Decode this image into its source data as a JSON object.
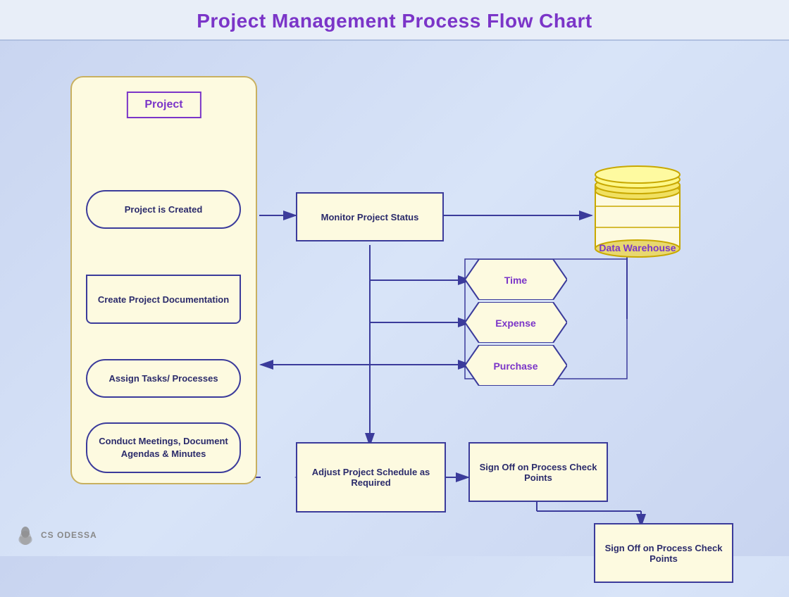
{
  "page": {
    "title": "Project Management Process Flow Chart",
    "background_color": "#c8d4f0"
  },
  "swimlane": {
    "title": "Project",
    "nodes": [
      {
        "id": "project-created",
        "label": "Project is Created",
        "type": "rounded"
      },
      {
        "id": "create-doc",
        "label": "Create Project Documentation",
        "type": "document"
      },
      {
        "id": "assign-tasks",
        "label": "Assign Tasks/ Processes",
        "type": "rounded"
      },
      {
        "id": "conduct-meetings",
        "label": "Conduct Meetings, Document Agendas & Minutes",
        "type": "rounded"
      }
    ]
  },
  "nodes": [
    {
      "id": "monitor-status",
      "label": "Monitor Project Status",
      "type": "rect"
    },
    {
      "id": "data-warehouse",
      "label": "Data Warehouse",
      "type": "cylinder"
    },
    {
      "id": "time",
      "label": "Time",
      "type": "hex"
    },
    {
      "id": "expense",
      "label": "Expense",
      "type": "hex"
    },
    {
      "id": "purchase",
      "label": "Purchase",
      "type": "hex"
    },
    {
      "id": "adjust-schedule",
      "label": "Adjust Project Schedule as Required",
      "type": "rect"
    },
    {
      "id": "signoff-1",
      "label": "Sign Off on Process Check Points",
      "type": "rect"
    },
    {
      "id": "signoff-2",
      "label": "Sign Off on Process Check Points",
      "type": "rect"
    }
  ],
  "logo": {
    "text": "CS ODESSA"
  }
}
